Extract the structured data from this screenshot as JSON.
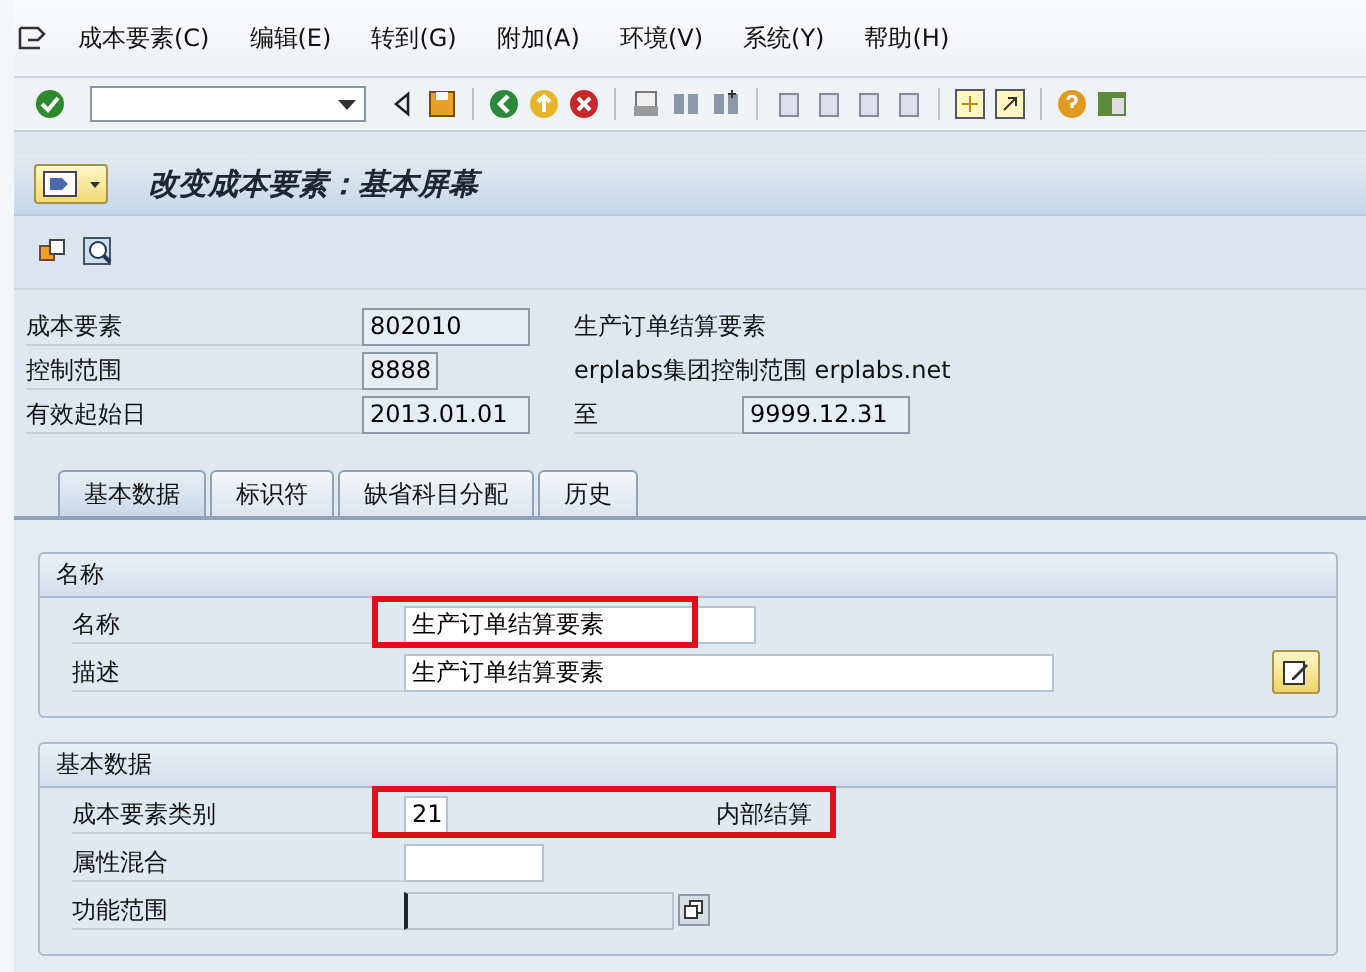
{
  "menu": [
    "成本要素(C)",
    "编辑(E)",
    "转到(G)",
    "附加(A)",
    "环境(V)",
    "系统(Y)",
    "帮助(H)"
  ],
  "title": "改变成本要素：基本屏幕",
  "header": [
    {
      "label": "成本要素",
      "value": "802010",
      "description": "生产订单结算要素"
    },
    {
      "label": "控制范围",
      "value": "8888",
      "description": "erplabs集团控制范围 erplabs.net"
    },
    {
      "label": "有效起始日",
      "value": "2013.01.01",
      "to_label": "至",
      "to_value": "9999.12.31"
    }
  ],
  "tabs": [
    {
      "label": "基本数据",
      "selected": true
    },
    {
      "label": "标识符",
      "selected": false
    },
    {
      "label": "缺省科目分配",
      "selected": false
    },
    {
      "label": "历史",
      "selected": false
    }
  ],
  "groups": [
    {
      "title": "名称",
      "rows": [
        {
          "label": "名称",
          "value": "生产订单结算要素",
          "highlighted": true,
          "focused": false
        },
        {
          "label": "描述",
          "value": "生产订单结算要素",
          "highlighted": false,
          "focused": false
        }
      ]
    },
    {
      "title": "基本数据",
      "rows": [
        {
          "label": "成本要素类别",
          "value": "21",
          "note": "内部结算",
          "highlighted": true,
          "focused": false
        },
        {
          "label": "属性混合",
          "highlighted": false,
          "focused": false
        },
        {
          "label": "功能范围",
          "highlighted": false,
          "focused": true
        }
      ]
    }
  ]
}
